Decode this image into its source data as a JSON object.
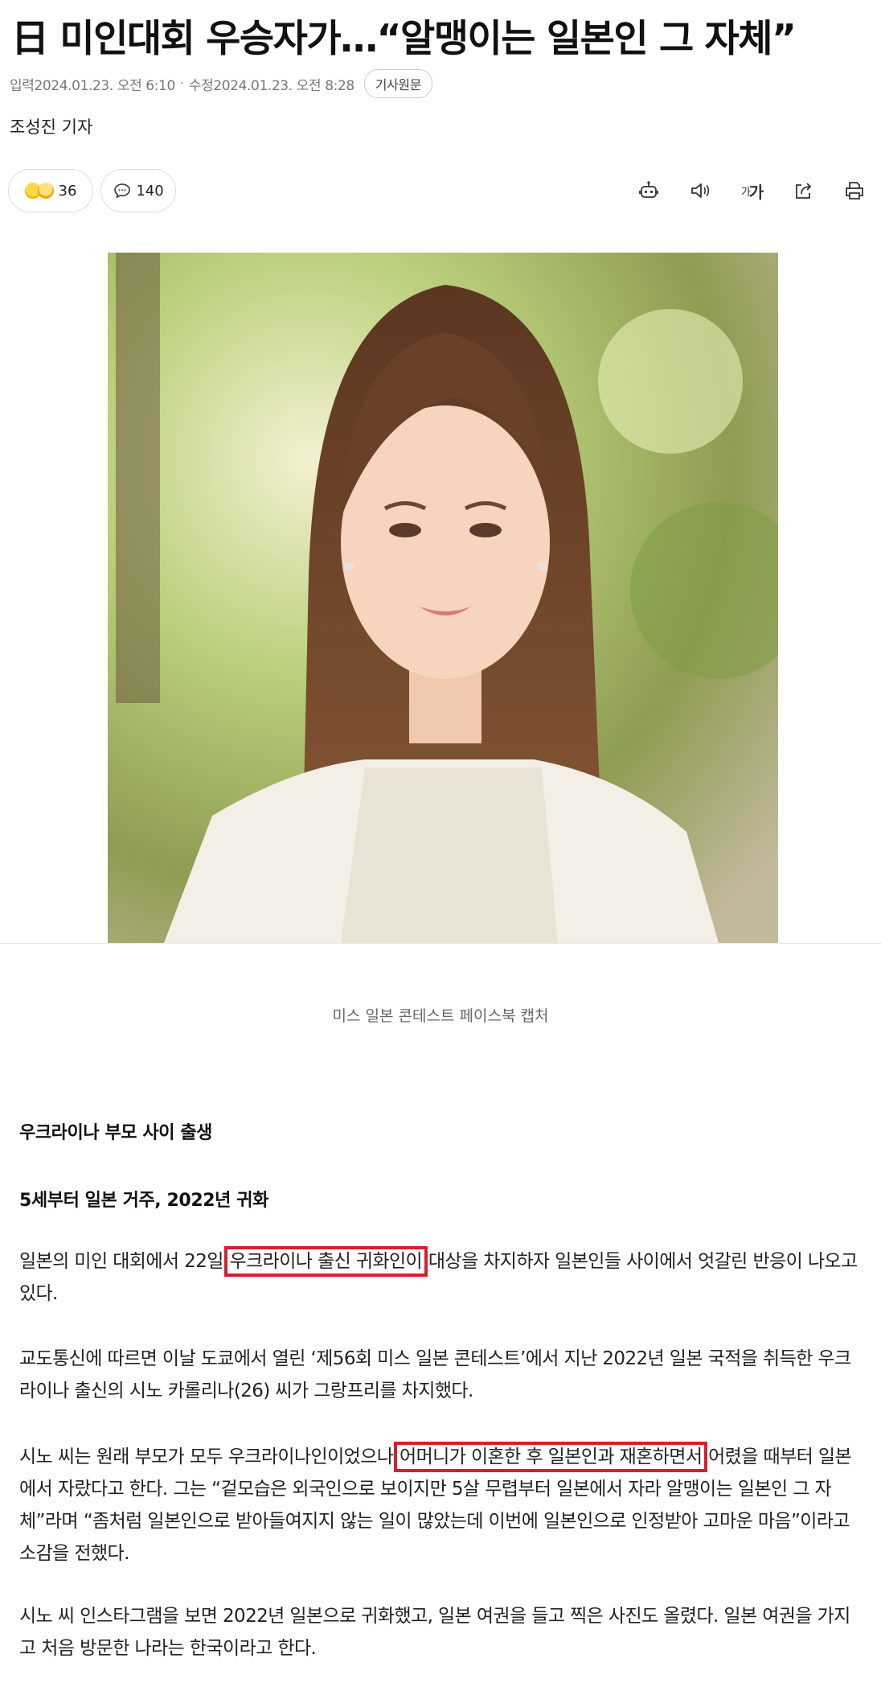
{
  "article": {
    "title": "日 미인대회 우승자가…“알맹이는 일본인 그 자체”",
    "input_label": "입력",
    "input_time": "2024.01.23. 오전 6:10",
    "separator": "·",
    "edit_label": "수정",
    "edit_time": "2024.01.23. 오전 8:28",
    "original_label": "기사원문",
    "reporter": "조성진 기자"
  },
  "engagement": {
    "reaction_count": "36",
    "comment_count": "140"
  },
  "toolbar": {
    "icons": [
      "robot-summary-icon",
      "speaker-icon",
      "font-size-icon",
      "share-icon",
      "print-icon"
    ],
    "font_small": "가",
    "font_large": "가"
  },
  "figure": {
    "caption": "미스 일본 콘테스트 페이스북 캡처"
  },
  "body": {
    "subtitle1": "우크라이나 부모 사이 출생",
    "subtitle2": "5세부터 일본 거주, 2022년 귀화",
    "p1_a": "일본의 미인 대회에서 22일 ",
    "p1_hl": "우크라이나 출신 귀화인이",
    "p1_b": " 대상을 차지하자 일본인들 사이에서 엇갈린 반응이 나오고 있다.",
    "p2": "교도통신에 따르면 이날 도쿄에서 열린 ‘제56회 미스 일본 콘테스트’에서 지난 2022년 일본 국적을 취득한 우크라이나 출신의 시노 카롤리나(26) 씨가 그랑프리를 차지했다.",
    "p3_a": "시노 씨는 원래 부모가 모두 우크라이나인이었으나 ",
    "p3_hl": "어머니가 이혼한 후 일본인과 재혼하면서",
    "p3_b": " 어렸을 때부터 일본에서 자랐다고 한다. 그는 “겉모습은 외국인으로 보이지만 5살 무렵부터 일본에서 자라 알맹이는 일본인 그 자체”라며 “좀처럼 일본인으로 받아들여지지 않는 일이 많았는데 이번에 일본인으로 인정받아 고마운 마음”이라고 소감을 전했다.",
    "p4": "시노 씨 인스타그램을 보면 2022년 일본으로 귀화했고, 일본 여권을 들고 찍은 사진도 올렸다. 일본 여권을 가지고 처음 방문한 나라는 한국이라고 한다."
  },
  "colors": {
    "highlight_box": "#d61f2b",
    "meta_text": "#777777"
  }
}
